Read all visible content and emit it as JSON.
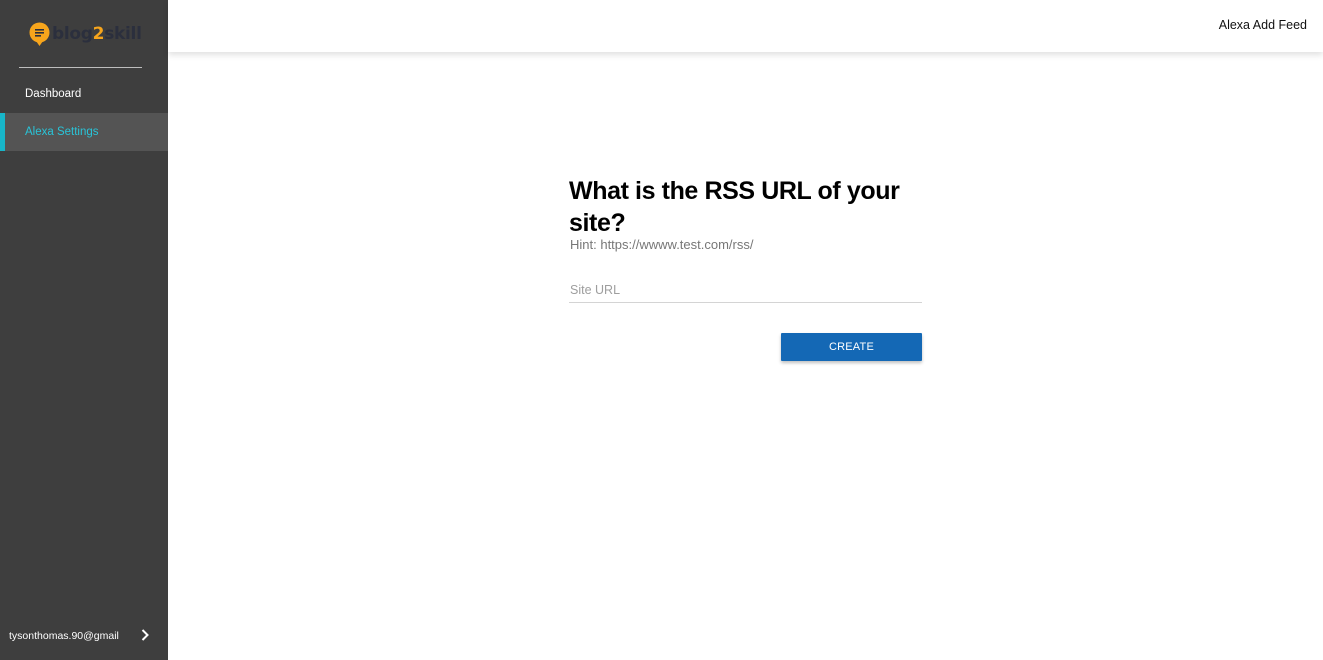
{
  "brand": {
    "logo_text": [
      "blog",
      "2",
      "skill"
    ],
    "logo_icon": "chat-bubble-icon",
    "colors": {
      "dark": "#2b2f3d",
      "accent": "#f7a51c"
    }
  },
  "sidebar": {
    "items": [
      {
        "label": "Dashboard",
        "active": false
      },
      {
        "label": "Alexa Settings",
        "active": true
      }
    ],
    "user": {
      "email": "tysonthomas.90@gmail",
      "icon": "chevron-right-icon"
    },
    "colors": {
      "background": "#3e3e3e",
      "active_bg": "#545454",
      "active_text": "#29c4d8",
      "active_bar": "#18b6c9"
    }
  },
  "header": {
    "title": "Alexa Add Feed"
  },
  "form": {
    "title": "What is the RSS URL of your site?",
    "hint": "Hint: https://wwww.test.com/rss/",
    "site_url": {
      "placeholder": "Site URL",
      "value": ""
    },
    "create_label": "CREATE",
    "button_color": "#1468b5"
  }
}
